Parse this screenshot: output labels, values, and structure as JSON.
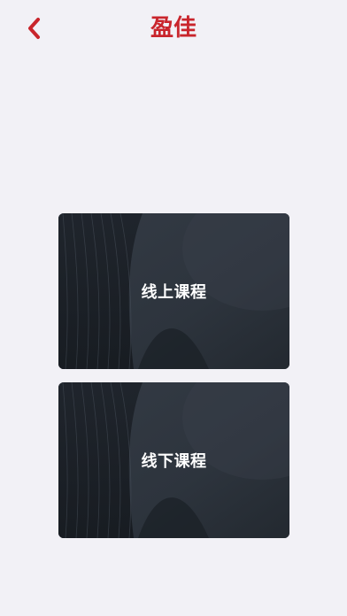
{
  "header": {
    "title": "盈佳",
    "back_icon": "chevron-left-icon"
  },
  "colors": {
    "accent": "#c9252c",
    "background": "#f2f1f6",
    "card_dark": "#2a3039"
  },
  "cards": [
    {
      "label": "线上课程"
    },
    {
      "label": "线下课程"
    }
  ]
}
